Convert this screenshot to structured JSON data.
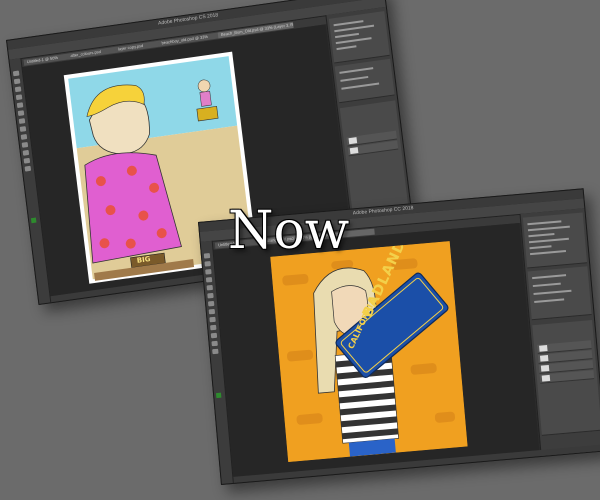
{
  "overlay": {
    "title": "Now"
  },
  "old_window": {
    "title": "Adobe Photoshop CS 2018",
    "tabs": [
      "Untitled-1 @ 50%",
      "after_colours.psd",
      "layer copy.psd",
      "beachboy_old.psd @ 33%",
      "Beach_Bum_Old.psd @ 33% (Layer 3, RGB/8)"
    ],
    "artwork": {
      "description": "beach cartoon",
      "belt_text": "BIG"
    }
  },
  "new_window": {
    "title": "Adobe Photoshop CC 2018",
    "tabs": [
      "Untitled-1",
      "Badlands_girl.psd @ 50% (Layer 1, RGB/8)"
    ],
    "artwork": {
      "sign_text_1": "BADLANDS",
      "sign_text_2": "CALIFORNIA"
    }
  },
  "colors": {
    "background": "#6b6b6b",
    "ps_dark": "#2b2b2b",
    "panel": "#3d3d3d",
    "orange_bg": "#f0a020",
    "sky": "#8fd8e8",
    "sand": "#e0cc98",
    "shirt_pink": "#e05fd0",
    "fg_swatch": "#2e8b2e"
  }
}
